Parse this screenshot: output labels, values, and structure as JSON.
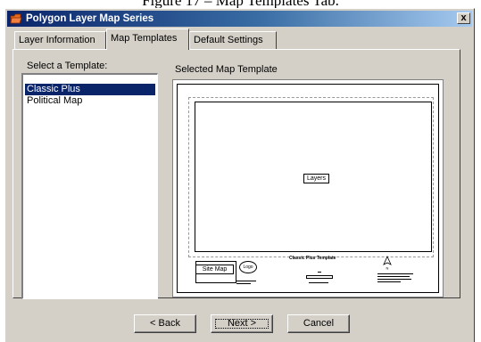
{
  "caption": "Figure 17 – Map Templates Tab.",
  "window": {
    "title": "Polygon Layer Map Series",
    "close_label": "x"
  },
  "tabs": [
    {
      "label": "Layer Information"
    },
    {
      "label": "Map Templates",
      "active": true
    },
    {
      "label": "Default Settings"
    }
  ],
  "left_panel": {
    "label": "Select a Template:",
    "templates": [
      "Classic Plus",
      "Political Map"
    ],
    "selected_index": 0
  },
  "right_panel": {
    "label": "Selected Map Template",
    "preview": {
      "layers_label": "Layers",
      "template_title": "Classic Plus Template",
      "site_map_label": "Site Map",
      "logo_label": "Logo",
      "north_label": "N"
    }
  },
  "buttons": {
    "back": "< Back",
    "next": "Next >",
    "cancel": "Cancel"
  },
  "colors": {
    "title_bar_start": "#0a246a",
    "title_bar_end": "#a6caf0",
    "selection": "#0a246a",
    "dialog_bg": "#d4d0c8"
  }
}
